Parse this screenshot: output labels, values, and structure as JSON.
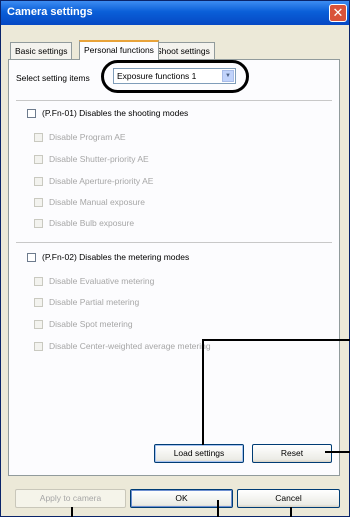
{
  "window": {
    "title": "Camera settings",
    "close_glyph": "✕"
  },
  "tabs": [
    {
      "label": "Basic settings",
      "active": false
    },
    {
      "label": "Personal functions",
      "active": true
    },
    {
      "label": "Shoot settings",
      "active": false
    }
  ],
  "select": {
    "label": "Select setting items",
    "value": "Exposure functions 1",
    "arrow_glyph": "▼"
  },
  "group1": {
    "title": "(P.Fn-01) Disables the shooting modes",
    "checked": false,
    "items": [
      "Disable Program AE",
      "Disable Shutter-priority AE",
      "Disable Aperture-priority AE",
      "Disable Manual exposure",
      "Disable Bulb exposure"
    ]
  },
  "group2": {
    "title": "(P.Fn-02) Disables the metering modes",
    "checked": false,
    "items": [
      "Disable Evaluative metering",
      "Disable Partial metering",
      "Disable Spot metering",
      "Disable Center-weighted average metering"
    ]
  },
  "buttons": {
    "load_settings": "Load settings",
    "reset": "Reset",
    "apply_to_camera": "Apply to camera",
    "ok": "OK",
    "cancel": "Cancel"
  },
  "colors": {
    "title_bar": "#0a5fd8",
    "dialog_bg": "#ece9d8",
    "panel_bg": "#fcfcfe",
    "annotation": "#000000"
  }
}
